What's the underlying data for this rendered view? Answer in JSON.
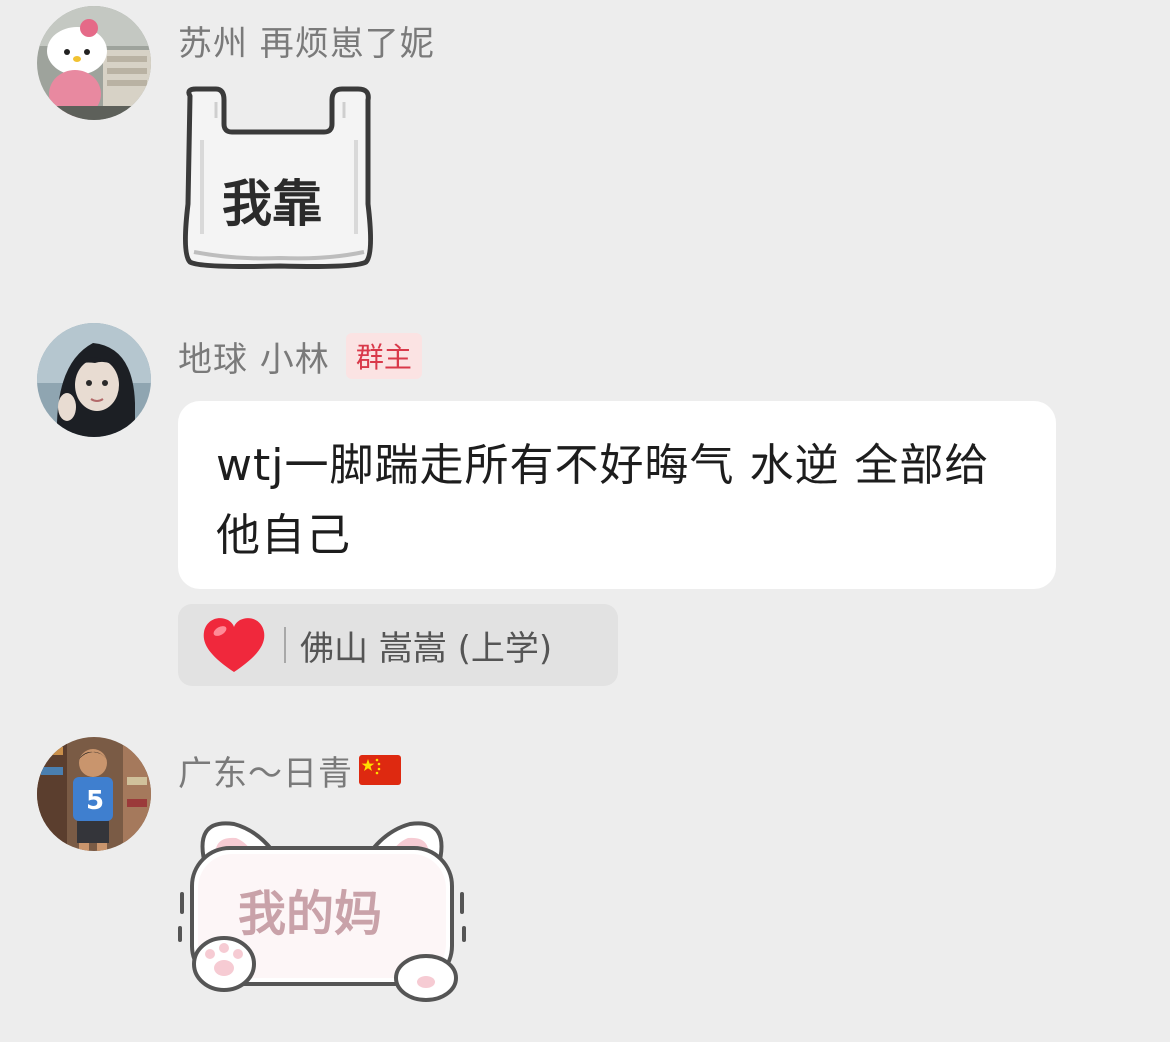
{
  "messages": [
    {
      "sender": "苏州 再烦崽了妮",
      "content_type": "sticker",
      "sticker_icon": "plastic-bag-sticker",
      "sticker_text": "我靠"
    },
    {
      "sender": "地球 小林",
      "role_badge": "群主",
      "content_type": "text",
      "text": "wtj一脚踹走所有不好晦气 水逆 全部给他自己",
      "reaction": {
        "icon": "red-heart-icon",
        "user": "佛山 嵩嵩 (上学)"
      }
    },
    {
      "sender": "广东～日青",
      "sender_flag": "china-flag-icon",
      "content_type": "sticker",
      "sticker_icon": "cat-paw-sticker",
      "sticker_text": "我的妈"
    }
  ],
  "colors": {
    "background": "#ededed",
    "bubble": "#ffffff",
    "name_text": "#7a7a7a",
    "badge_bg": "#fbe3e3",
    "badge_text": "#d9394a",
    "reaction_bg": "#e2e2e2",
    "heart": "#f0283c"
  }
}
